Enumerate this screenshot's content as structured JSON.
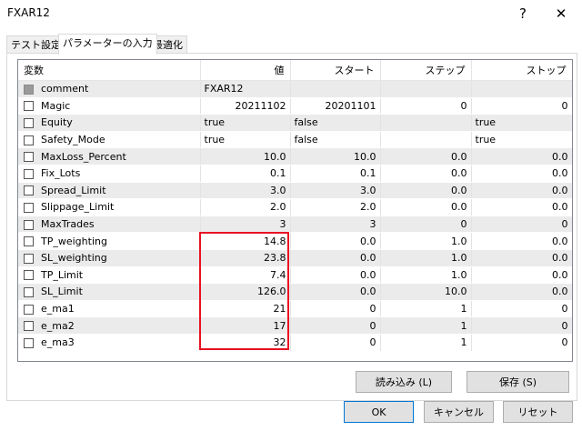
{
  "window": {
    "title": "FXAR12",
    "help_glyph": "?",
    "close_glyph": "✕"
  },
  "tabs": [
    {
      "label": "テスト設定",
      "active": false
    },
    {
      "label": "パラメーターの入力",
      "active": true
    },
    {
      "label": "最適化",
      "active": false
    }
  ],
  "table": {
    "headers": {
      "name": "変数",
      "value": "値",
      "start": "スタート",
      "step": "ステップ",
      "stop": "ストップ"
    },
    "rows": [
      {
        "name": "comment",
        "value": "FXAR12",
        "start": "",
        "step": "",
        "stop": "",
        "checkbox_disabled": true,
        "text": true
      },
      {
        "name": "Magic",
        "value": "20211102",
        "start": "20201101",
        "step": "0",
        "stop": "0"
      },
      {
        "name": "Equity",
        "value": "true",
        "start": "false",
        "step": "",
        "stop": "true",
        "text": true
      },
      {
        "name": "Safety_Mode",
        "value": "true",
        "start": "false",
        "step": "",
        "stop": "true",
        "text": true
      },
      {
        "name": "MaxLoss_Percent",
        "value": "10.0",
        "start": "10.0",
        "step": "0.0",
        "stop": "0.0"
      },
      {
        "name": "Fix_Lots",
        "value": "0.1",
        "start": "0.1",
        "step": "0.0",
        "stop": "0.0"
      },
      {
        "name": "Spread_Limit",
        "value": "3.0",
        "start": "3.0",
        "step": "0.0",
        "stop": "0.0"
      },
      {
        "name": "Slippage_Limit",
        "value": "2.0",
        "start": "2.0",
        "step": "0.0",
        "stop": "0.0"
      },
      {
        "name": "MaxTrades",
        "value": "3",
        "start": "3",
        "step": "0",
        "stop": "0"
      },
      {
        "name": "TP_weighting",
        "value": "14.8",
        "start": "0.0",
        "step": "1.0",
        "stop": "0.0"
      },
      {
        "name": "SL_weighting",
        "value": "23.8",
        "start": "0.0",
        "step": "1.0",
        "stop": "0.0"
      },
      {
        "name": "TP_Limit",
        "value": "7.4",
        "start": "0.0",
        "step": "1.0",
        "stop": "0.0"
      },
      {
        "name": "SL_Limit",
        "value": "126.0",
        "start": "0.0",
        "step": "10.0",
        "stop": "0.0"
      },
      {
        "name": "e_ma1",
        "value": "21",
        "start": "0",
        "step": "1",
        "stop": "0"
      },
      {
        "name": "e_ma2",
        "value": "17",
        "start": "0",
        "step": "1",
        "stop": "0"
      },
      {
        "name": "e_ma3",
        "value": "32",
        "start": "0",
        "step": "1",
        "stop": "0"
      }
    ]
  },
  "buttons": {
    "load": "読み込み (L)",
    "save": "保存 (S)",
    "ok": "OK",
    "cancel": "キャンセル",
    "reset": "リセット"
  },
  "colors": {
    "highlight": "#e81123",
    "default_button_border": "#0078d7"
  }
}
